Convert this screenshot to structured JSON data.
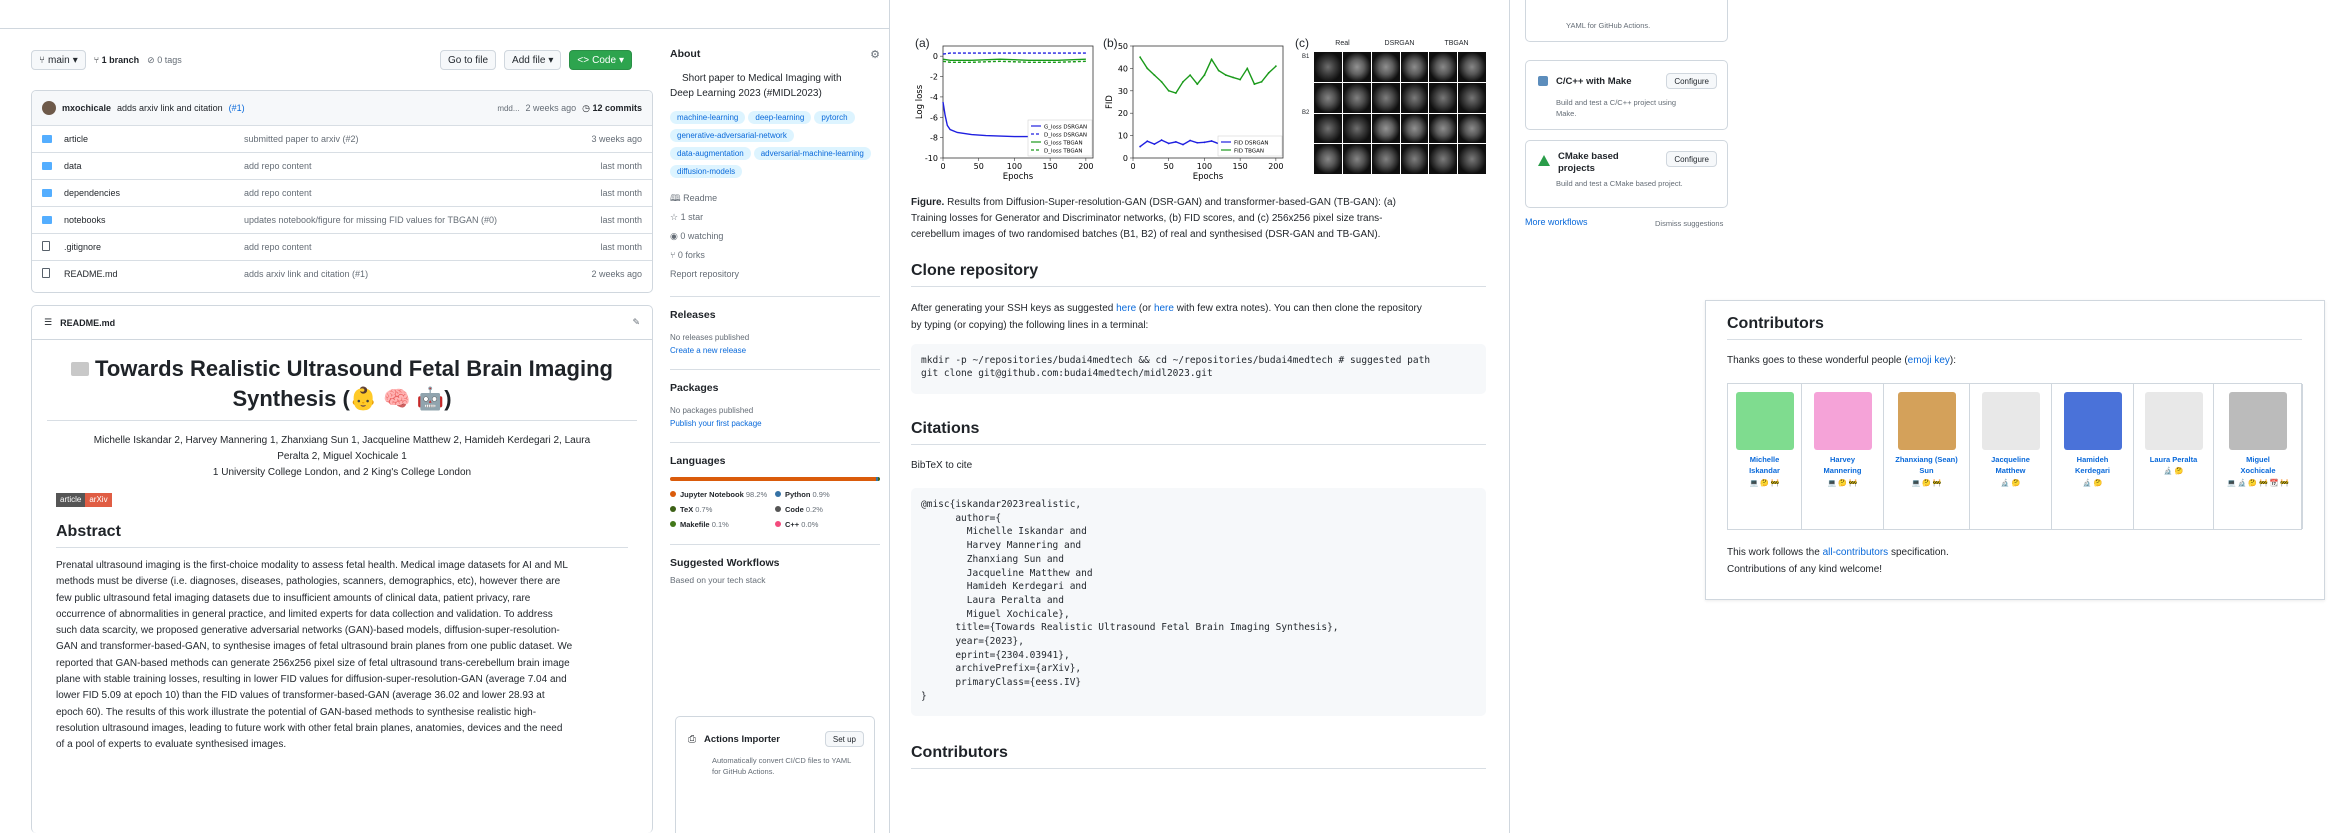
{
  "repo_bar": {
    "branch": "main",
    "branches": "1 branch",
    "tags": "0 tags",
    "go_to_file": "Go to file",
    "add_file": "Add file",
    "code": "Code"
  },
  "commit": {
    "author": "mxochicale",
    "message": "adds arxiv link and citation",
    "pr": "(#1)",
    "hash": "mdd...",
    "time": "2 weeks ago",
    "count": "12 commits"
  },
  "files": [
    {
      "name": "article",
      "type": "folder",
      "msg": "submitted paper to arxiv (#2)",
      "time": "3 weeks ago"
    },
    {
      "name": "data",
      "type": "folder",
      "msg": "add repo content",
      "time": "last month"
    },
    {
      "name": "dependencies",
      "type": "folder",
      "msg": "add repo content",
      "time": "last month"
    },
    {
      "name": "notebooks",
      "type": "folder",
      "msg": "updates notebook/figure for missing FID values for TBGAN (#0)",
      "time": "last month"
    },
    {
      "name": ".gitignore",
      "type": "file",
      "msg": "add repo content",
      "time": "last month"
    },
    {
      "name": "README.md",
      "type": "file",
      "msg": "adds arxiv link and citation (#1)",
      "time": "2 weeks ago"
    }
  ],
  "readme": {
    "header": "README.md",
    "title_line1": "Towards Realistic Ultrasound Fetal Brain Imaging",
    "title_line2": "Synthesis (👶 🧠 🤖)",
    "authors_line1": "Michelle Iskandar 2, Harvey Mannering 1, Zhanxiang Sun 1, Jacqueline Matthew 2, Hamideh Kerdegari 2, Laura",
    "authors_line2": "Peralta 2, Miguel Xochicale 1",
    "affiliations": "1 University College London, and 2 King's College London",
    "badge_left": "article",
    "badge_right": "arXiv",
    "abstract_heading": "Abstract",
    "abstract_lines": [
      "Prenatal ultrasound imaging is the first-choice modality to assess fetal health. Medical image datasets for AI and ML",
      "methods must be diverse (i.e. diagnoses, diseases, pathologies, scanners, demographics, etc), however there are",
      "few public ultrasound fetal imaging datasets due to insufficient amounts of clinical data, patient privacy, rare",
      "occurrence of abnormalities in general practice, and limited experts for data collection and validation. To address",
      "such data scarcity, we proposed generative adversarial networks (GAN)-based models, diffusion-super-resolution-",
      "GAN and transformer-based-GAN, to synthesise images of fetal ultrasound brain planes from one public dataset. We",
      "reported that GAN-based methods can generate 256x256 pixel size of fetal ultrasound trans-cerebellum brain image",
      "plane with stable training losses, resulting in lower FID values for diffusion-super-resolution-GAN (average 7.04 and",
      "lower FID 5.09 at epoch 10) than the FID values of transformer-based-GAN (average 36.02 and lower 28.93 at",
      "epoch 60). The results of this work illustrate the potential of GAN-based methods to synthesise realistic high-",
      "resolution ultrasound images, leading to future work with other fetal brain planes, anatomies, devices and the need",
      "of a pool of experts to evaluate synthesised images."
    ]
  },
  "about": {
    "heading": "About",
    "description_line1": "Short paper to Medical Imaging with",
    "description_line2": "Deep Learning 2023 (#MIDL2023)",
    "topics": [
      "machine-learning",
      "deep-learning",
      "pytorch",
      "generative-adversarial-network",
      "data-augmentation",
      "adversarial-machine-learning",
      "diffusion-models"
    ],
    "readme": "Readme",
    "stars": "1 star",
    "watching": "0 watching",
    "forks": "0 forks",
    "report": "Report repository"
  },
  "releases": {
    "heading": "Releases",
    "none": "No releases published",
    "create": "Create a new release"
  },
  "packages": {
    "heading": "Packages",
    "none": "No packages published",
    "publish": "Publish your first package"
  },
  "languages": {
    "heading": "Languages",
    "items": [
      {
        "name": "Jupyter Notebook",
        "pct": "98.2%",
        "color": "#DA5B0B"
      },
      {
        "name": "Python",
        "pct": "0.9%",
        "color": "#3572A5"
      },
      {
        "name": "TeX",
        "pct": "0.7%",
        "color": "#3D6117"
      },
      {
        "name": "Code",
        "pct": "0.2%",
        "color": "#555555"
      },
      {
        "name": "Makefile",
        "pct": "0.1%",
        "color": "#427819"
      },
      {
        "name": "C++",
        "pct": "0.0%",
        "color": "#f34b7d"
      }
    ]
  },
  "workflows": {
    "heading": "Suggested Workflows",
    "sub": "Based on your tech stack",
    "actions_importer": "Actions Importer",
    "setup": "Set up",
    "actions_desc": "Automatically convert CI/CD files to YAML for GitHub Actions."
  },
  "figure": {
    "panel_a": "(a)",
    "panel_b": "(b)",
    "panel_c": "(c)",
    "caption_bold": "Figure.",
    "caption_lines": [
      "Results from Diffusion-Super-resolution-GAN (DSR-GAN) and transformer-based-GAN (TB-GAN): (a)",
      "Training losses for Generator and Discriminator networks, (b) FID scores, and (c) 256x256 pixel size trans-",
      "cerebellum images of two randomised batches (B1, B2) of real and synthesised (DSR-GAN and TB-GAN)."
    ],
    "img_headers": [
      "Real",
      "DSRGAN",
      "TBGAN"
    ],
    "img_rows": [
      "B1",
      "B2"
    ]
  },
  "chart_data": [
    {
      "type": "line",
      "ylabel": "Log loss",
      "xlabel": "Epochs",
      "x_ticks": [
        0,
        50,
        100,
        150,
        200
      ],
      "y_ticks": [
        0,
        -2,
        -4,
        -6,
        -8,
        -10
      ],
      "ylim": [
        -10,
        1
      ],
      "xlim": [
        0,
        210
      ],
      "legend": "right",
      "series": [
        {
          "name": "G_loss DSRGAN",
          "color": "#1f1fe0",
          "x": [
            0,
            3,
            6,
            10,
            20,
            40,
            60,
            100,
            150,
            200
          ],
          "y": [
            -4.5,
            -5.8,
            -6.8,
            -7.2,
            -7.5,
            -7.7,
            -7.8,
            -7.9,
            -7.9,
            -8.0
          ]
        },
        {
          "name": "D_loss DSRGAN",
          "color": "#1f1fe0",
          "x": [
            0,
            10,
            40,
            80,
            120,
            160,
            200
          ],
          "y": [
            0.2,
            0.3,
            0.3,
            0.3,
            0.3,
            0.3,
            0.3
          ]
        },
        {
          "name": "G_loss TBGAN",
          "color": "#1a9a1a",
          "x": [
            0,
            10,
            40,
            80,
            120,
            160,
            200
          ],
          "y": [
            -0.3,
            -0.4,
            -0.4,
            -0.3,
            -0.4,
            -0.4,
            -0.3
          ]
        },
        {
          "name": "D_loss TBGAN",
          "color": "#1a9a1a",
          "x": [
            0,
            10,
            40,
            80,
            120,
            160,
            200
          ],
          "y": [
            -0.5,
            -0.6,
            -0.6,
            -0.5,
            -0.6,
            -0.6,
            -0.5
          ]
        }
      ]
    },
    {
      "type": "line",
      "ylabel": "FID",
      "xlabel": "Epochs",
      "x_ticks": [
        0,
        50,
        100,
        150,
        200
      ],
      "y_ticks": [
        0,
        10,
        20,
        30,
        40,
        50
      ],
      "ylim": [
        0,
        50
      ],
      "xlim": [
        0,
        210
      ],
      "legend": "right",
      "series": [
        {
          "name": "FID DSRGAN",
          "color": "#1f1fe0",
          "x": [
            10,
            20,
            30,
            40,
            50,
            60,
            70,
            80,
            90,
            100,
            110,
            120,
            130,
            140,
            150,
            160,
            170,
            180,
            190,
            200
          ],
          "y": [
            5.1,
            7.5,
            6.2,
            8.0,
            6.5,
            7.2,
            6.0,
            7.8,
            6.8,
            7.0,
            7.6,
            6.4,
            7.3,
            6.6,
            7.9,
            6.9,
            7.1,
            7.4,
            6.7,
            7.2
          ]
        },
        {
          "name": "FID TBGAN",
          "color": "#1a9a1a",
          "x": [
            10,
            20,
            30,
            40,
            50,
            60,
            70,
            80,
            90,
            100,
            110,
            120,
            130,
            140,
            150,
            160,
            170,
            180,
            190,
            200
          ],
          "y": [
            45,
            40,
            37,
            34,
            30,
            29,
            34,
            37,
            33,
            37,
            44,
            39,
            37,
            36,
            35,
            40,
            33,
            34,
            38,
            41
          ]
        }
      ]
    }
  ],
  "clone": {
    "heading": "Clone repository",
    "text_line1_pre": "After generating your SSH keys as suggested",
    "here1": "here",
    "text_mid": "(or",
    "here2": "here",
    "text_line1_post": "with few extra notes). You can then clone the repository",
    "text_line2": "by typing (or copying) the following lines in a terminal:",
    "code": "mkdir -p ~/repositories/budai4medtech && cd ~/repositories/budai4medtech # suggested path\ngit clone git@github.com:budai4medtech/midl2023.git"
  },
  "citations": {
    "heading": "Citations",
    "sub": "BibTeX to cite",
    "code": "@misc{iskandar2023realistic,\n      author={\n        Michelle Iskandar and\n        Harvey Mannering and\n        Zhanxiang Sun and\n        Jacqueline Matthew and\n        Hamideh Kerdegari and\n        Laura Peralta and\n        Miguel Xochicale},\n      title={Towards Realistic Ultrasound Fetal Brain Imaging Synthesis},\n      year={2023},\n      eprint={2304.03941},\n      archivePrefix={arXiv},\n      primaryClass={eess.IV}\n}"
  },
  "contributors_bottom": {
    "heading": "Contributors"
  },
  "right_workflows": {
    "top_desc": "YAML for GitHub Actions.",
    "cpp_title": "C/C++ with Make",
    "cpp_desc": "Build and test a C/C++ project using Make.",
    "cmake_title_line1": "CMake based",
    "cmake_title_line2": "projects",
    "cmake_desc": "Build and test a CMake based project.",
    "configure": "Configure",
    "more": "More workflows",
    "dismiss": "Dismiss suggestions"
  },
  "contributors": {
    "heading": "Contributors",
    "thanks_pre": "Thanks goes to these wonderful people (",
    "thanks_link": "emoji key",
    "thanks_post": "):",
    "people": [
      {
        "name_line1": "Michelle",
        "name_line2": "Iskandar",
        "emojis": "💻 🤔 🚧"
      },
      {
        "name_line1": "Harvey",
        "name_line2": "Mannering",
        "emojis": "💻 🤔 🚧"
      },
      {
        "name_line1": "Zhanxiang (Sean)",
        "name_line2": "Sun",
        "emojis": "💻 🤔 🚧"
      },
      {
        "name_line1": "Jacqueline",
        "name_line2": "Matthew",
        "emojis": "🔬 🤔"
      },
      {
        "name_line1": "Hamideh",
        "name_line2": "Kerdegari",
        "emojis": "🔬 🤔"
      },
      {
        "name_line1": "Laura Peralta",
        "name_line2": "",
        "emojis": "🔬 🤔"
      },
      {
        "name_line1": "Miguel",
        "name_line2": "Xochicale",
        "emojis": "💻 🔬 🤔 🚧 📆 🚧"
      }
    ],
    "follows_pre": "This work follows the",
    "follows_link": "all-contributors",
    "follows_post": "specification.",
    "welcome": "Contributions of any kind welcome!"
  }
}
